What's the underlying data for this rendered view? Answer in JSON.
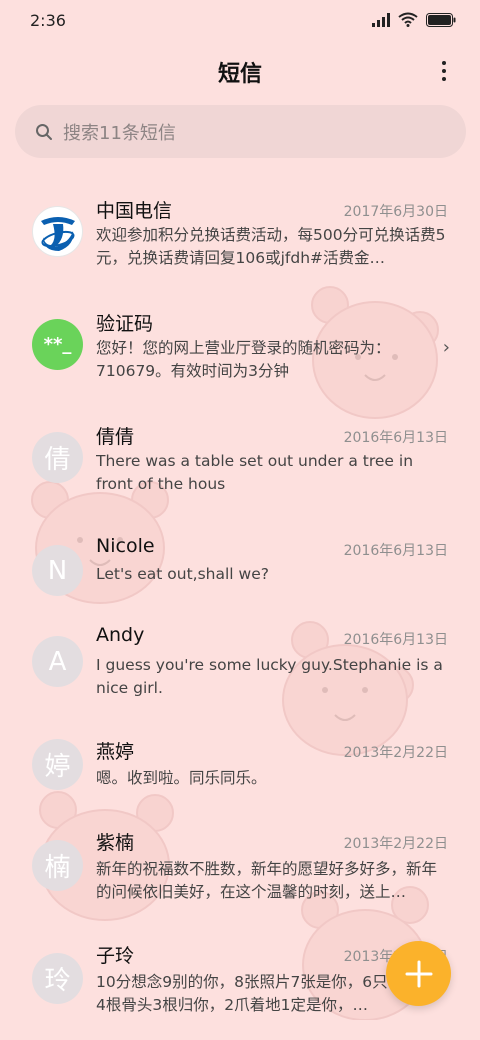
{
  "status_bar": {
    "time": "2:36"
  },
  "header": {
    "title": "短信"
  },
  "search": {
    "placeholder": "搜索11条短信"
  },
  "messages": [
    {
      "avatar_text": "",
      "name": "中国电信",
      "date": "2017年6月30日",
      "preview": "欢迎参加积分兑换话费活动，每500分可兑换话费5元，兑换话费请回复106或jfdh#活费金…"
    },
    {
      "avatar_text": "**_",
      "name": "验证码",
      "date": "",
      "preview": "您好！您的网上营业厅登录的随机密码为：710679。有效时间为3分钟"
    },
    {
      "avatar_text": "倩",
      "name": "倩倩",
      "date": "2016年6月13日",
      "preview": "There was a table set out under a tree in front of the hous"
    },
    {
      "avatar_text": "N",
      "name": "Nicole",
      "date": "2016年6月13日",
      "preview": "Let's eat out,shall we?"
    },
    {
      "avatar_text": "A",
      "name": "Andy",
      "date": "2016年6月13日",
      "preview": "I guess you're some lucky guy.Stephanie is a nice girl."
    },
    {
      "avatar_text": "婷",
      "name": "燕婷",
      "date": "2013年2月22日",
      "preview": "嗯。收到啦。同乐同乐。"
    },
    {
      "avatar_text": "楠",
      "name": "紫楠",
      "date": "2013年2月22日",
      "preview": "新年的祝福数不胜数，新年的愿望好多好多，新年的问候依旧美好，在这个温馨的时刻，送上…"
    },
    {
      "avatar_text": "玲",
      "name": "子玲",
      "date": "2013年2月22日",
      "preview": "10分想念9别的你，8张照片7张是你，6只像你，4根骨头3根归你，2爪着地1定是你，…"
    }
  ],
  "colors": {
    "background": "#fde0de",
    "fab": "#fbb22b",
    "verify_avatar": "#6ad35a",
    "telecom_blue": "#0a5fb0"
  }
}
